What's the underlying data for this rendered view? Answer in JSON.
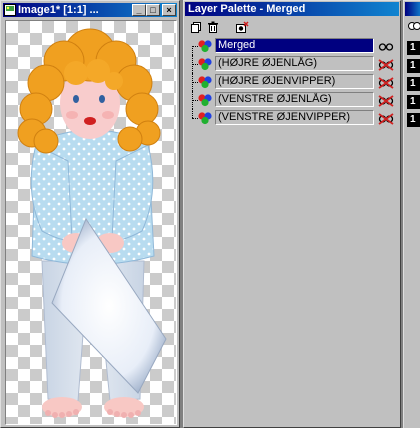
{
  "image_window": {
    "title": "Image1* [1:1] ...",
    "minimize_glyph": "_",
    "maximize_glyph": "□",
    "close_glyph": "×"
  },
  "layer_palette": {
    "title": "Layer Palette - Merged",
    "toolbar": {
      "icons": [
        "new-layer-icon",
        "delete-layer-icon",
        "mask-icon"
      ]
    },
    "layers": [
      {
        "name": "Merged",
        "visible": true,
        "selected": true
      },
      {
        "name": "(HØJRE ØJENLÅG)",
        "visible": false,
        "selected": false
      },
      {
        "name": "(HØJRE ØJENVIPPER)",
        "visible": false,
        "selected": false
      },
      {
        "name": "(VENSTRE ØJENLÅG)",
        "visible": false,
        "selected": false
      },
      {
        "name": "(VENSTRE ØJENVIPPER)",
        "visible": false,
        "selected": false
      }
    ]
  },
  "right_window": {
    "chips": [
      "1",
      "1",
      "1",
      "1",
      "1"
    ]
  },
  "colors": {
    "title_active": "#000080",
    "title_gradient_end": "#1084d0",
    "selection": "#000080",
    "chrome": "#c0c0c0",
    "hair": "#f0a020",
    "shirt": "#b8dcf0",
    "pants": "#d8e0ec",
    "skin": "#f8c8c4"
  }
}
